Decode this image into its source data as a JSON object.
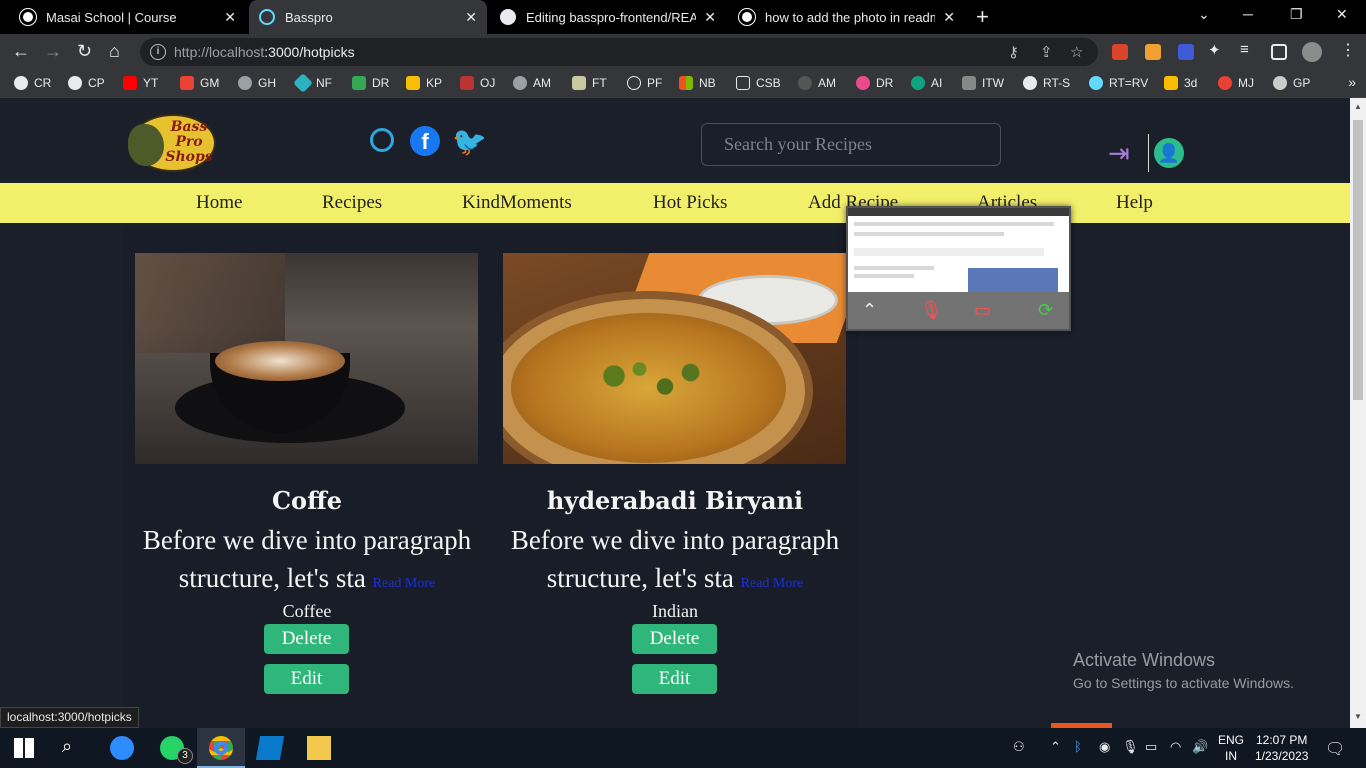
{
  "browser": {
    "tabs": [
      {
        "title": "Masai School | Course",
        "active": false
      },
      {
        "title": "Basspro",
        "active": true
      },
      {
        "title": "Editing basspro-frontend/READM",
        "active": false
      },
      {
        "title": "how to add the photo in readme",
        "active": false
      }
    ],
    "url_host": "http://localhost",
    "url_path": ":3000/hotpicks",
    "bookmarks": [
      "CR",
      "CP",
      "YT",
      "GM",
      "GH",
      "NF",
      "DR",
      "KP",
      "OJ",
      "AM",
      "FT",
      "PF",
      "NB",
      "CSB",
      "AM",
      "DR",
      "AI",
      "ITW",
      "RT-S",
      "RT=RV",
      "3d",
      "MJ",
      "GP"
    ],
    "status_url": "localhost:3000/hotpicks"
  },
  "site": {
    "logo_text": "Bass Pro Shops",
    "search_placeholder": "Search your Recipes",
    "nav": [
      "Home",
      "Recipes",
      "KindMoments",
      "Hot Picks",
      "Add Recipe",
      "Articles",
      "Help"
    ]
  },
  "recipes": [
    {
      "title": "Coffe",
      "desc": "Before we dive into paragraph structure, let's sta",
      "read_more": "Read More",
      "category": "Coffee",
      "delete_label": "Delete",
      "edit_label": "Edit"
    },
    {
      "title": "hyderabadi Biryani",
      "desc": "Before we dive into paragraph structure, let's sta",
      "read_more": "Read More",
      "category": "Indian",
      "delete_label": "Delete",
      "edit_label": "Edit"
    }
  ],
  "watermark": {
    "line1": "Activate Windows",
    "line2": "Go to Settings to activate Windows."
  },
  "taskbar": {
    "whatsapp_badge": "3",
    "lang_line1": "ENG",
    "lang_line2": "IN",
    "time": "12:07 PM",
    "date": "1/23/2023"
  }
}
